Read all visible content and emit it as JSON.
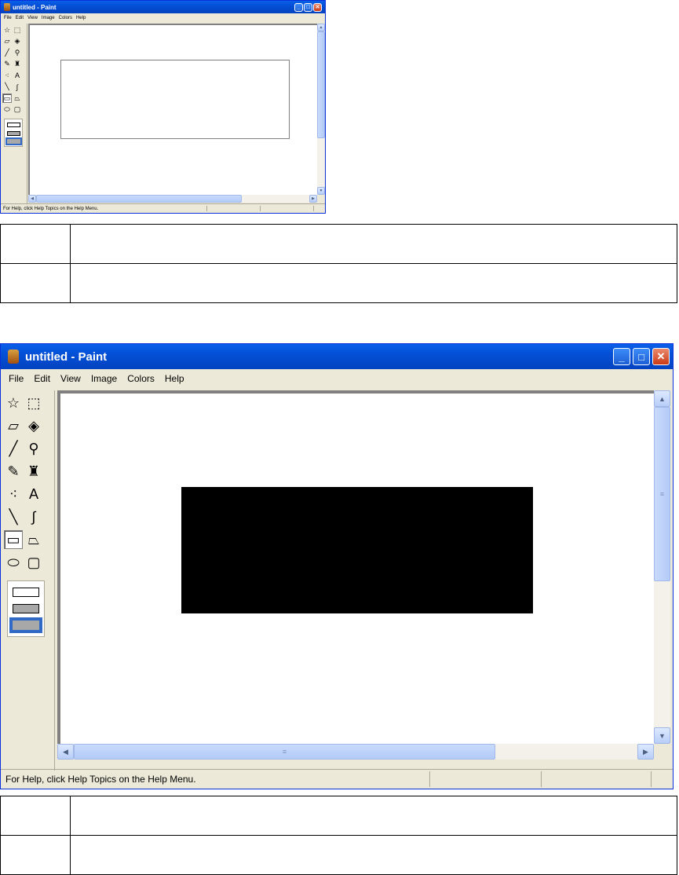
{
  "window": {
    "title": "untitled - Paint",
    "minimize_glyph": "_",
    "maximize_glyph": "□",
    "close_glyph": "✕"
  },
  "menu": [
    {
      "label": "File"
    },
    {
      "label": "Edit"
    },
    {
      "label": "View"
    },
    {
      "label": "Image"
    },
    {
      "label": "Colors"
    },
    {
      "label": "Help"
    }
  ],
  "tools": [
    {
      "name": "free-form-select-icon",
      "glyph": "☆"
    },
    {
      "name": "rect-select-icon",
      "glyph": "⬚"
    },
    {
      "name": "eraser-icon",
      "glyph": "▱"
    },
    {
      "name": "fill-bucket-icon",
      "glyph": "◈"
    },
    {
      "name": "color-picker-icon",
      "glyph": "╱"
    },
    {
      "name": "magnifier-icon",
      "glyph": "⚲"
    },
    {
      "name": "pencil-icon",
      "glyph": "✎"
    },
    {
      "name": "brush-icon",
      "glyph": "♜"
    },
    {
      "name": "airbrush-icon",
      "glyph": "⁖"
    },
    {
      "name": "text-tool-icon",
      "glyph": "A"
    },
    {
      "name": "line-icon",
      "glyph": "╲"
    },
    {
      "name": "curve-icon",
      "glyph": "∫"
    },
    {
      "name": "rectangle-icon",
      "glyph": "▭"
    },
    {
      "name": "polygon-icon",
      "glyph": "⏢"
    },
    {
      "name": "ellipse-icon",
      "glyph": "⬭"
    },
    {
      "name": "rounded-rect-icon",
      "glyph": "▢"
    }
  ],
  "selected_tool": "rectangle-icon",
  "shape_on_canvas": {
    "top_screenshot": "outline",
    "bottom_screenshot": "filled"
  },
  "colors": {
    "title_blue": "#0450d6",
    "shape_fill_bottom": "#000000",
    "shape_stroke_top": "#808080"
  },
  "status": {
    "text": "For Help, click Help Topics on the Help Menu."
  },
  "icons": {
    "scroll_up": "▲",
    "scroll_down": "▼",
    "scroll_left": "◀",
    "scroll_right": "▶",
    "thumb_grip": "≡"
  }
}
